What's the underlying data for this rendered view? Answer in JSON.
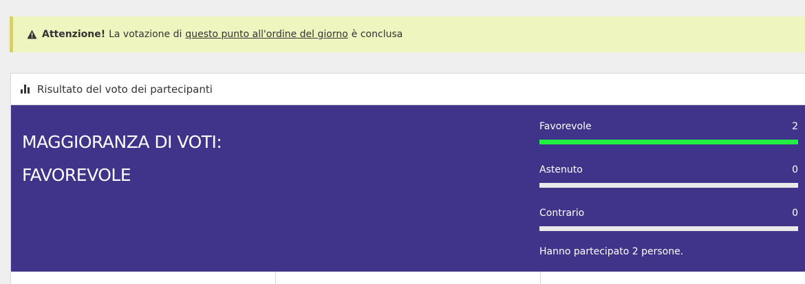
{
  "alert": {
    "strong": "Attenzione!",
    "text_before": "La votazione di",
    "link": "questo punto all'ordine del giorno",
    "text_after": "è conclusa",
    "icon": "warning-icon",
    "bg_color": "#eef5bf",
    "border_color": "#d8cf6a"
  },
  "panel": {
    "title": "Risultato del voto dei partecipanti",
    "icon": "bar-chart-icon",
    "result_bg_color": "#3f338a",
    "majority_line1": "MAGGIORANZA DI VOTI:",
    "majority_line2": "FAVOREVOLE",
    "votes": [
      {
        "label": "Favorevole",
        "count": "2",
        "fraction": 1.0,
        "color": "#22ee44"
      },
      {
        "label": "Astenuto",
        "count": "0",
        "fraction": 0.0,
        "color": "#22ee44"
      },
      {
        "label": "Contrario",
        "count": "0",
        "fraction": 0.0,
        "color": "#22ee44"
      }
    ],
    "participants": "Hanno partecipato 2 persone."
  }
}
